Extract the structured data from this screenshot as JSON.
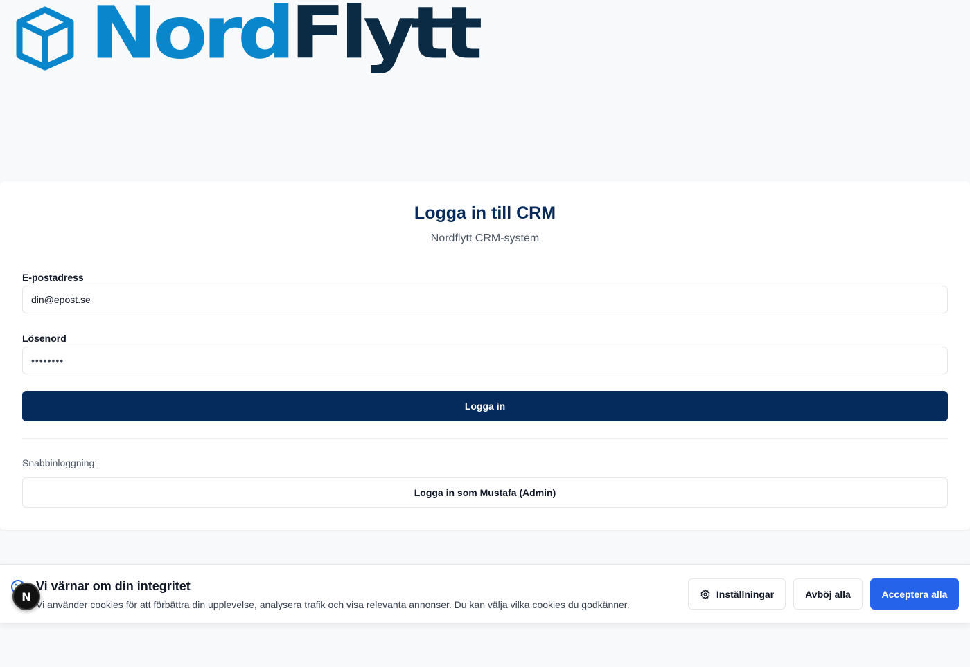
{
  "brand": {
    "logo_part1": "Nord",
    "logo_part2": "Flytt",
    "primary_color": "#0a86cc",
    "secondary_color": "#0b2a44",
    "icon": "box-icon"
  },
  "login": {
    "title": "Logga in till CRM",
    "subtitle": "Nordflytt CRM-system",
    "email_label": "E-postadress",
    "email_placeholder": "din@epost.se",
    "password_label": "Lösenord",
    "password_placeholder": "••••••••",
    "submit_label": "Logga in",
    "quick_login_label": "Snabbinloggning:",
    "quick_login_button": "Logga in som Mustafa (Admin)",
    "button_color": "#052a5c"
  },
  "cookie_banner": {
    "icon": "cookie-icon",
    "title": "Vi värnar om din integritet",
    "text": "Vi använder cookies för att förbättra din upplevelse, analysera trafik och visa relevanta annonser. Du kan välja vilka cookies du godkänner.",
    "settings_label": "Inställningar",
    "reject_label": "Avböj alla",
    "accept_label": "Acceptera alla",
    "accept_color": "#2563eb"
  },
  "dev_badge": {
    "letter": "N",
    "icon": "nextjs-icon"
  }
}
